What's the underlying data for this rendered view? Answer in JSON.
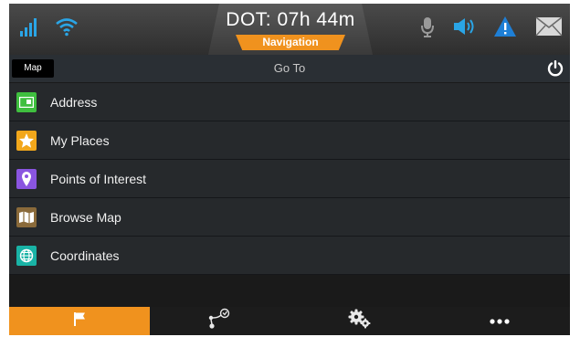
{
  "status": {
    "dot_text": "DOT: 07h 44m",
    "mode_label": "Navigation",
    "icons": [
      "signal-icon",
      "wifi-icon",
      "microphone-icon",
      "speaker-icon",
      "warning-icon",
      "mail-icon"
    ],
    "colors": {
      "accent": "#f0921e",
      "signal": "#2aa5e6"
    }
  },
  "header": {
    "map_button": "Map",
    "title": "Go To",
    "power_icon": "power-icon"
  },
  "menu": [
    {
      "label": "Address",
      "icon": "address-card-icon",
      "color": "#3fbf3f"
    },
    {
      "label": "My Places",
      "icon": "star-icon",
      "color": "#f2a71b"
    },
    {
      "label": "Points of Interest",
      "icon": "location-pin-icon",
      "color": "#8a55e0"
    },
    {
      "label": "Browse Map",
      "icon": "map-icon",
      "color": "#8a6a3a"
    },
    {
      "label": "Coordinates",
      "icon": "globe-icon",
      "color": "#19b3a6"
    }
  ],
  "tabs": [
    {
      "name": "flag-icon",
      "active": true
    },
    {
      "name": "route-icon",
      "active": false
    },
    {
      "name": "settings-icon",
      "active": false
    },
    {
      "name": "more-icon",
      "active": false
    }
  ]
}
